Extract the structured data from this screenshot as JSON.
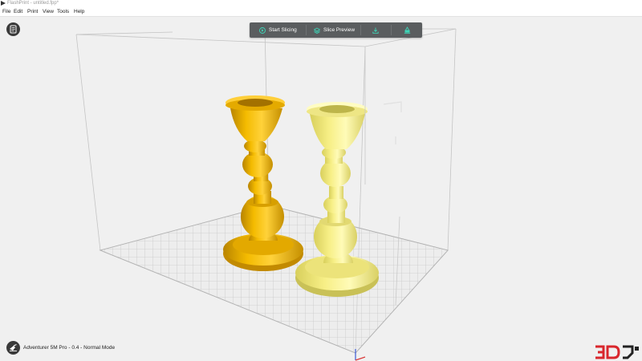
{
  "window": {
    "title": "FlashPrint - untitled.fpp*"
  },
  "menu": {
    "items": [
      "File",
      "Edit",
      "Print",
      "View",
      "Tools",
      "Help"
    ]
  },
  "toolbar": {
    "start_slicing": "Start Slicing",
    "slice_preview": "Slice Preview"
  },
  "status": {
    "text": "Adventurer 5M Pro - 0.4 - Normal Mode"
  },
  "icons": {
    "app": "flashprint-app-icon",
    "info": "document-icon",
    "start_slicing": "play-icon",
    "slice_preview": "layers-icon",
    "export": "download-icon",
    "send": "send-to-printer-icon",
    "printer": "printer-icon"
  },
  "colors": {
    "accent": "#3dd6b8",
    "model_left": "#f4bb00",
    "model_right": "#f7ef86",
    "toolbar_bg": "#5a5d5f",
    "logo_red": "#d9262c"
  }
}
